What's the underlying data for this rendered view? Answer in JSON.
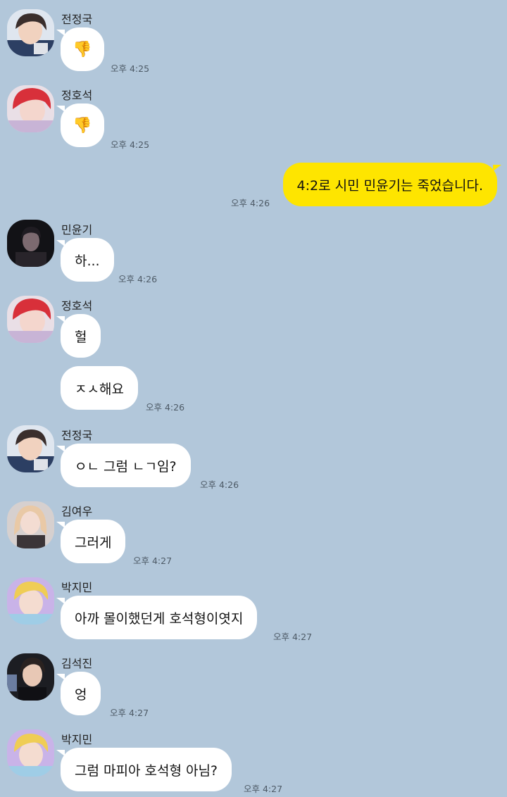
{
  "messages": [
    {
      "sender": "전정국",
      "text": "👎",
      "time": "오후 4:25"
    },
    {
      "sender": "정호석",
      "text": "👎",
      "time": "오후 4:25"
    },
    {
      "sender": "me",
      "text": "4:2로 시민 민윤기는 죽었습니다.",
      "time": "오후 4:26"
    },
    {
      "sender": "민윤기",
      "text": "하...",
      "time": "오후 4:26"
    },
    {
      "sender": "정호석",
      "text": "헐",
      "time": ""
    },
    {
      "sender": "정호석",
      "text": "ㅈㅅ해요",
      "time": "오후 4:26"
    },
    {
      "sender": "전정국",
      "text": "ㅇㄴ 그럼 ㄴㄱ임?",
      "time": "오후 4:26"
    },
    {
      "sender": "김여우",
      "text": "그러게",
      "time": "오후 4:27"
    },
    {
      "sender": "박지민",
      "text": "아까 몰이했던게 호석형이엿지",
      "time": "오후 4:27"
    },
    {
      "sender": "김석진",
      "text": "엉",
      "time": "오후 4:27"
    },
    {
      "sender": "박지민",
      "text": "그럼 마피아 호석형 아님?",
      "time": "오후 4:27"
    }
  ],
  "colors": {
    "background": "#b2c7da",
    "incoming_bubble": "#ffffff",
    "outgoing_bubble": "#fee500"
  }
}
